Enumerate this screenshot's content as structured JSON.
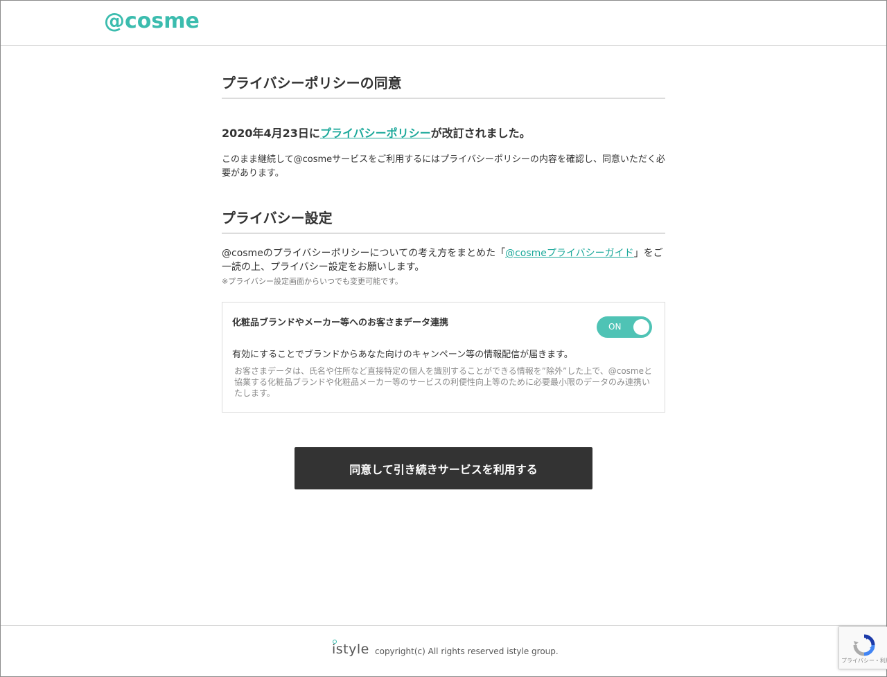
{
  "header": {
    "logo": "@cosme"
  },
  "agreement": {
    "title": "プライバシーポリシーの同意",
    "revised_prefix": "2020年4月23日に",
    "revised_link": "プライバシーポリシー",
    "revised_suffix": "が改訂されました。",
    "body": "このまま継続して@cosmeサービスをご利用するにはプライバシーポリシーの内容を確認し、同意いただく必要があります。"
  },
  "privacy_settings": {
    "title": "プライバシー設定",
    "guide_prefix": "@cosmeのプライバシーポリシーについての考え方をまとめた「",
    "guide_link": "@cosmeプライバシーガイド",
    "guide_suffix": "」をご一読の上、プライバシー設定をお願いします。",
    "note": "※プライバシー設定画面からいつでも変更可能です。",
    "data_sharing": {
      "label": "化粧品ブランドやメーカー等へのお客さまデータ連携",
      "toggle_state": "ON",
      "description": "有効にすることでブランドからあなた向けのキャンペーン等の情報配信が届きます。",
      "fine_print": "お客さまデータは、氏名や住所など直接特定の個人を識別することができる情報を”除外”した上で、@cosmeと協業する化粧品ブランドや化粧品メーカー等のサービスの利便性向上等のために必要最小限のデータのみ連携いたします。"
    }
  },
  "cta": {
    "label": "同意して引き続きサービスを利用する"
  },
  "footer": {
    "logo": "istyle",
    "copyright": "copyright(c) All rights reserved istyle group."
  },
  "recaptcha": {
    "text": "プライバシー・利用規約"
  },
  "colors": {
    "brand": "#3bbcae",
    "link": "#1aa89a",
    "toggle_on": "#4fc3b5",
    "button": "#333333"
  }
}
